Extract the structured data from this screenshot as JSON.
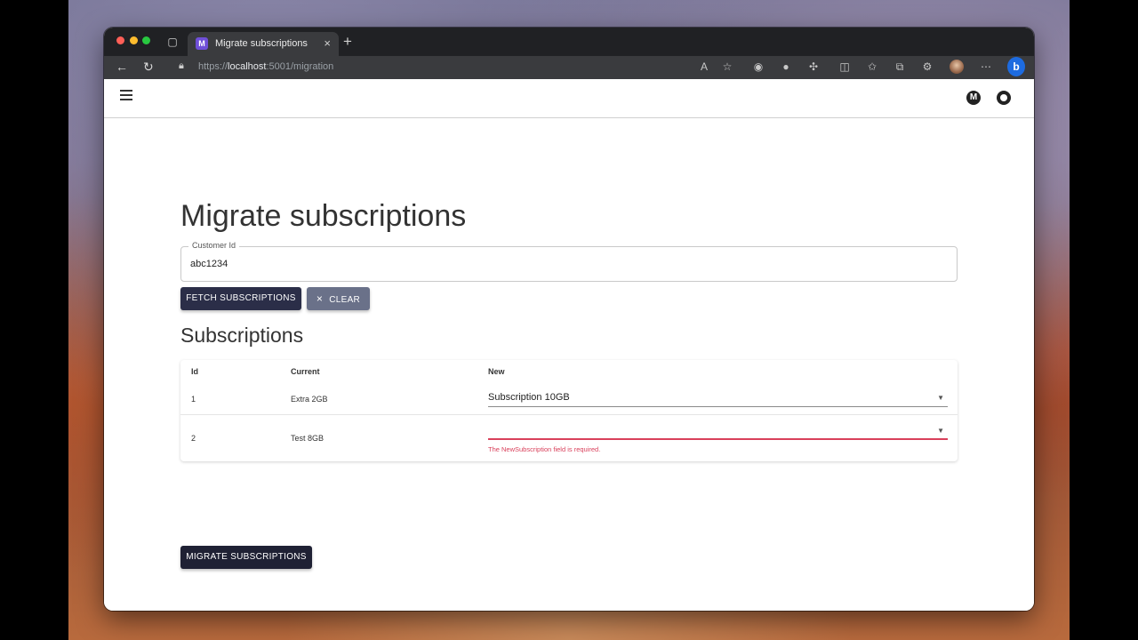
{
  "browser": {
    "tab_title": "Migrate subscriptions",
    "tab_favicon": "M",
    "url_scheme": "https://",
    "url_host": "localhost",
    "url_rest": ":5001/migration",
    "new_tab": "+",
    "tab_close": "×",
    "bing_label": "b"
  },
  "appbar": {
    "mud_logo": "M"
  },
  "main": {
    "title": "Migrate subscriptions",
    "customer_field": {
      "label": "Customer Id",
      "value": "abc1234"
    },
    "fetch_button": "Fetch subscriptions",
    "clear_button": "Clear",
    "clear_icon": "×",
    "subscriptions_heading": "Subscriptions",
    "table": {
      "headers": [
        "Id",
        "Current",
        "New"
      ],
      "rows": [
        {
          "id": "1",
          "current": "Extra 2GB",
          "new": "Subscription 10GB",
          "error": ""
        },
        {
          "id": "2",
          "current": "Test 8GB",
          "new": "",
          "error": "The NewSubscription field is required."
        }
      ]
    },
    "migrate_button": "Migrate subscriptions"
  }
}
